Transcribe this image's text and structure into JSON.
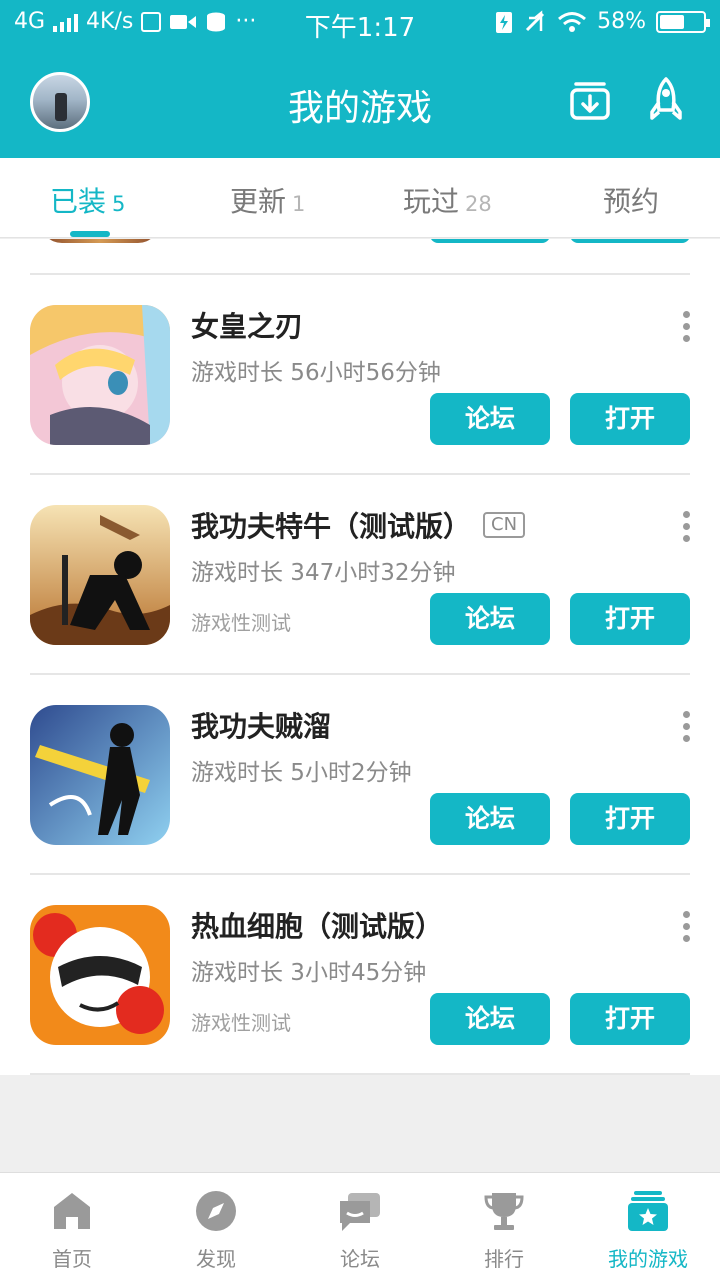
{
  "status_bar": {
    "network": "4G",
    "speed": "4K/s",
    "dots": "···",
    "time": "下午1:17",
    "battery_percent": "58%",
    "battery_level": 0.58
  },
  "header": {
    "title": "我的游戏"
  },
  "tabs": [
    {
      "label": "已装",
      "count": "5",
      "active": true
    },
    {
      "label": "更新",
      "count": "1",
      "active": false
    },
    {
      "label": "玩过",
      "count": "28",
      "active": false
    },
    {
      "label": "预约",
      "count": "",
      "active": false
    }
  ],
  "games": [
    {
      "name": "女皇之刃",
      "tag": "",
      "playtime": "游戏时长 56小时56分钟",
      "note": "",
      "forum_label": "论坛",
      "open_label": "打开"
    },
    {
      "name": "我功夫特牛（测试版）",
      "tag": "CN",
      "playtime": "游戏时长 347小时32分钟",
      "note": "游戏性测试",
      "forum_label": "论坛",
      "open_label": "打开"
    },
    {
      "name": "我功夫贼溜",
      "tag": "",
      "playtime": "游戏时长 5小时2分钟",
      "note": "",
      "forum_label": "论坛",
      "open_label": "打开"
    },
    {
      "name": "热血细胞（测试版）",
      "tag": "",
      "playtime": "游戏时长 3小时45分钟",
      "note": "游戏性测试",
      "forum_label": "论坛",
      "open_label": "打开"
    }
  ],
  "bottom_nav": [
    {
      "label": "首页",
      "icon": "home-icon",
      "active": false
    },
    {
      "label": "发现",
      "icon": "compass-icon",
      "active": false
    },
    {
      "label": "论坛",
      "icon": "forum-icon",
      "active": false
    },
    {
      "label": "排行",
      "icon": "trophy-icon",
      "active": false
    },
    {
      "label": "我的游戏",
      "icon": "my-games-icon",
      "active": true
    }
  ],
  "colors": {
    "accent": "#14b7c6",
    "inactive": "#8a8a8a"
  }
}
